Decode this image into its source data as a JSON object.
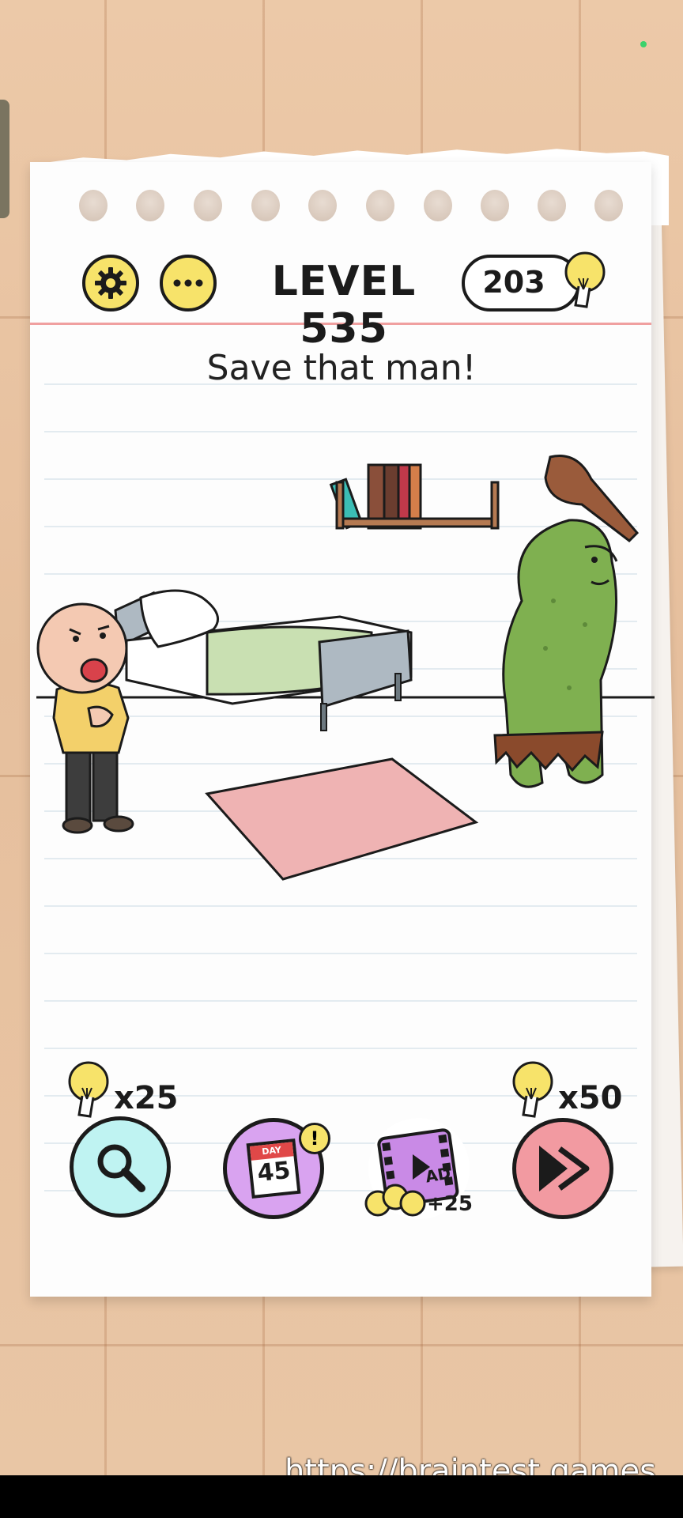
{
  "header": {
    "level_label": "LEVEL 535",
    "hint_count": "203"
  },
  "puzzle": {
    "prompt": "Save that man!"
  },
  "tools": {
    "hint_cost": "x25",
    "skip_cost": "x50",
    "daily_day_label": "DAY",
    "daily_day_number": "45",
    "daily_badge": "!",
    "ad_label": "AD",
    "ad_reward": "+25"
  },
  "footer": {
    "url": "https://braintest.games"
  },
  "colors": {
    "button_yellow": "#f7e36a",
    "hint_tool_bg": "#bff3f2",
    "daily_tool_bg": "#d9a3f0",
    "ad_tool_bg": "#ffffff",
    "skip_tool_bg": "#f29aa1",
    "bed_blanket": "#c9e0b2",
    "rug": "#efb3b3",
    "troll": "#7fb050"
  }
}
